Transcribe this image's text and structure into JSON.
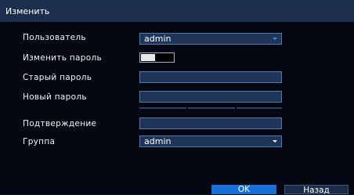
{
  "dialog": {
    "title": "Изменить",
    "labels": {
      "user": "Пользователь",
      "change_password": "Изменить пароль",
      "old_password": "Старый пароль",
      "new_password": "Новый пароль",
      "confirm": "Подтверждение",
      "group": "Группа"
    },
    "user_value": "admin",
    "group_value": "admin",
    "change_password_enabled": false,
    "buttons": {
      "ok": "OK",
      "back": "Назад"
    },
    "colors": {
      "accent": "#1a6fd6",
      "titlebar": "#1b2e4c",
      "field": "#1e3557"
    }
  }
}
